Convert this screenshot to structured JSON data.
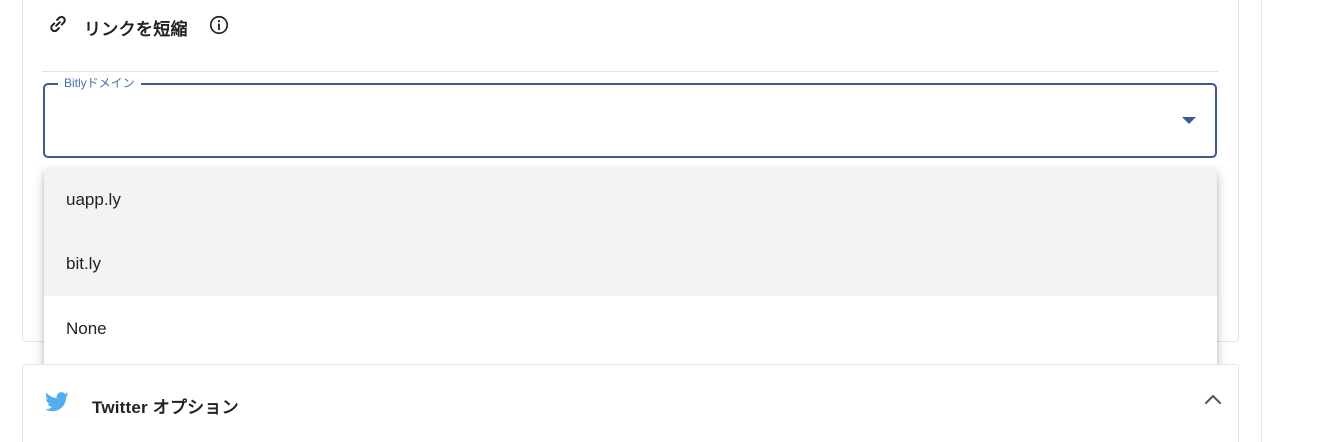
{
  "shorten_section": {
    "icon": "link-icon",
    "title": "リンクを短縮",
    "info_icon": "info-icon"
  },
  "bitly_select": {
    "label": "Bitlyドメイン",
    "value": "",
    "expanded": true,
    "accent_color": "#3b5b95",
    "options": [
      "uapp.ly",
      "bit.ly",
      "None"
    ]
  },
  "twitter_section": {
    "icon": "twitter-bird-icon",
    "title": "Twitter オプション",
    "brand_color": "#55acee",
    "collapse_icon": "chevron-up-icon"
  }
}
